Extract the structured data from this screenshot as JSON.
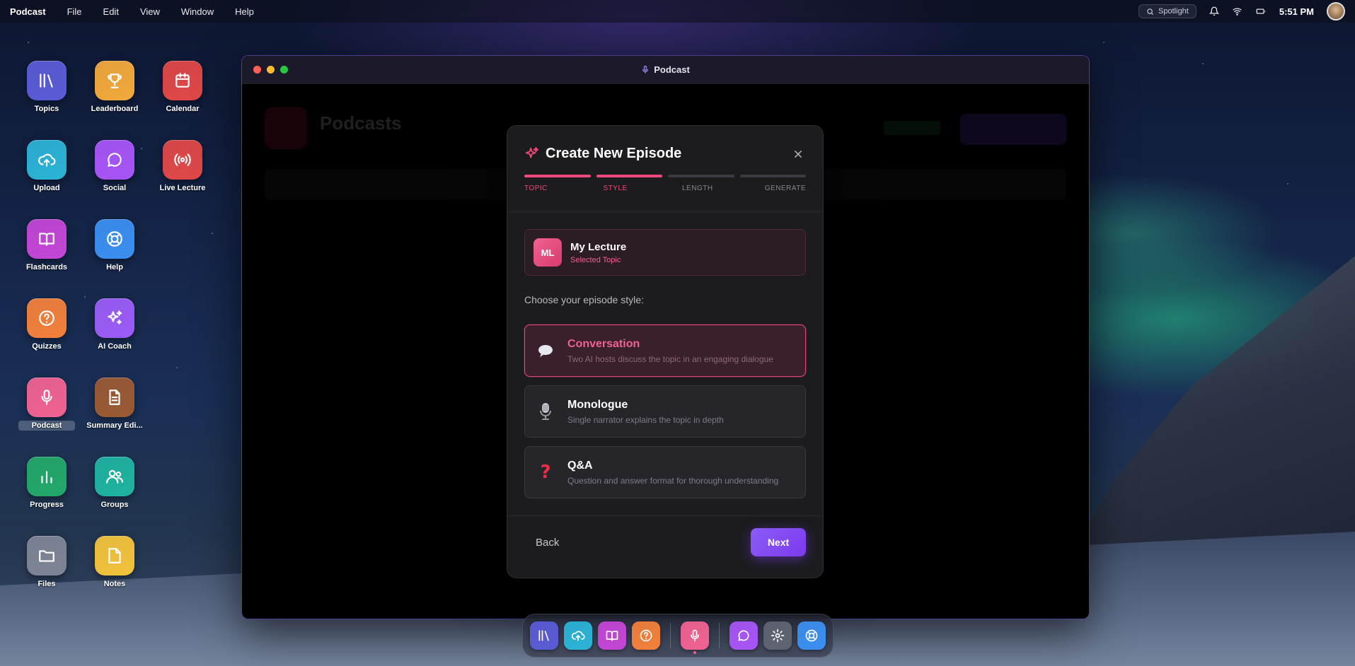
{
  "menubar": {
    "app_name": "Podcast",
    "menus": [
      "File",
      "Edit",
      "View",
      "Window",
      "Help"
    ],
    "spotlight": "Spotlight",
    "time": "5:51 PM"
  },
  "desktop": {
    "icons": [
      {
        "label": "Topics",
        "icon": "library-icon",
        "color": "#5b5bd6"
      },
      {
        "label": "Leaderboard",
        "icon": "trophy-icon",
        "color": "#f2a93b"
      },
      {
        "label": "Calendar",
        "icon": "calendar-icon",
        "color": "#e04848"
      },
      {
        "label": "Upload",
        "icon": "upload-cloud-icon",
        "color": "#2bb3d6"
      },
      {
        "label": "Social",
        "icon": "chat-bubble-icon",
        "color": "#a855f7"
      },
      {
        "label": "Live Lecture",
        "icon": "broadcast-icon",
        "color": "#e04848"
      },
      {
        "label": "Flashcards",
        "icon": "book-icon",
        "color": "#c446d6"
      },
      {
        "label": "Help",
        "icon": "lifebuoy-icon",
        "color": "#3b8ff0"
      },
      {
        "label": "Quizzes",
        "icon": "question-icon",
        "color": "#f2803b"
      },
      {
        "label": "AI Coach",
        "icon": "sparkles-icon",
        "color": "#9b5cf6"
      },
      {
        "label": "Podcast",
        "icon": "microphone-icon",
        "color": "#f06292"
      },
      {
        "label": "Summary Edi...",
        "icon": "document-icon",
        "color": "#9a5a34"
      },
      {
        "label": "Progress",
        "icon": "bar-chart-icon",
        "color": "#22a86a"
      },
      {
        "label": "Groups",
        "icon": "users-icon",
        "color": "#1fb3a0"
      },
      {
        "label": "Files",
        "icon": "folder-icon",
        "color": "#7d8595"
      },
      {
        "label": "Notes",
        "icon": "note-icon",
        "color": "#f2c23b"
      }
    ]
  },
  "window": {
    "title": "Podcast",
    "background": {
      "heading": "Podcasts"
    }
  },
  "modal": {
    "title": "Create New Episode",
    "steps": [
      {
        "name": "TOPIC",
        "done": true
      },
      {
        "name": "STYLE",
        "done": true
      },
      {
        "name": "LENGTH",
        "done": false
      },
      {
        "name": "GENERATE",
        "done": false
      }
    ],
    "topic": {
      "initials": "ML",
      "name": "My Lecture",
      "sub": "Selected Topic"
    },
    "choose_label": "Choose your episode style:",
    "options": [
      {
        "emoji": "💬",
        "title": "Conversation",
        "desc": "Two AI hosts discuss the topic in an engaging dialogue",
        "selected": true
      },
      {
        "emoji": "🎙️",
        "title": "Monologue",
        "desc": "Single narrator explains the topic in depth",
        "selected": false
      },
      {
        "emoji": "❓",
        "title": "Q&A",
        "desc": "Question and answer format for thorough understanding",
        "selected": false
      }
    ],
    "back_label": "Back",
    "next_label": "Next"
  },
  "dock": {
    "items": [
      {
        "icon": "library-icon",
        "color": "#5b5bd6"
      },
      {
        "icon": "upload-cloud-icon",
        "color": "#2bb3d6"
      },
      {
        "icon": "book-icon",
        "color": "#c446d6"
      },
      {
        "icon": "question-icon",
        "color": "#f2803b"
      },
      {
        "icon": "microphone-icon",
        "color": "#f06292",
        "active": true
      },
      {
        "icon": "chat-bubble-icon",
        "color": "#a855f7"
      },
      {
        "icon": "gear-icon",
        "color": "#5f6472"
      },
      {
        "icon": "lifebuoy-icon",
        "color": "#3b8ff0"
      }
    ]
  },
  "colors": {
    "accent": "#f0487a",
    "primary_button": "#7c3aed"
  }
}
